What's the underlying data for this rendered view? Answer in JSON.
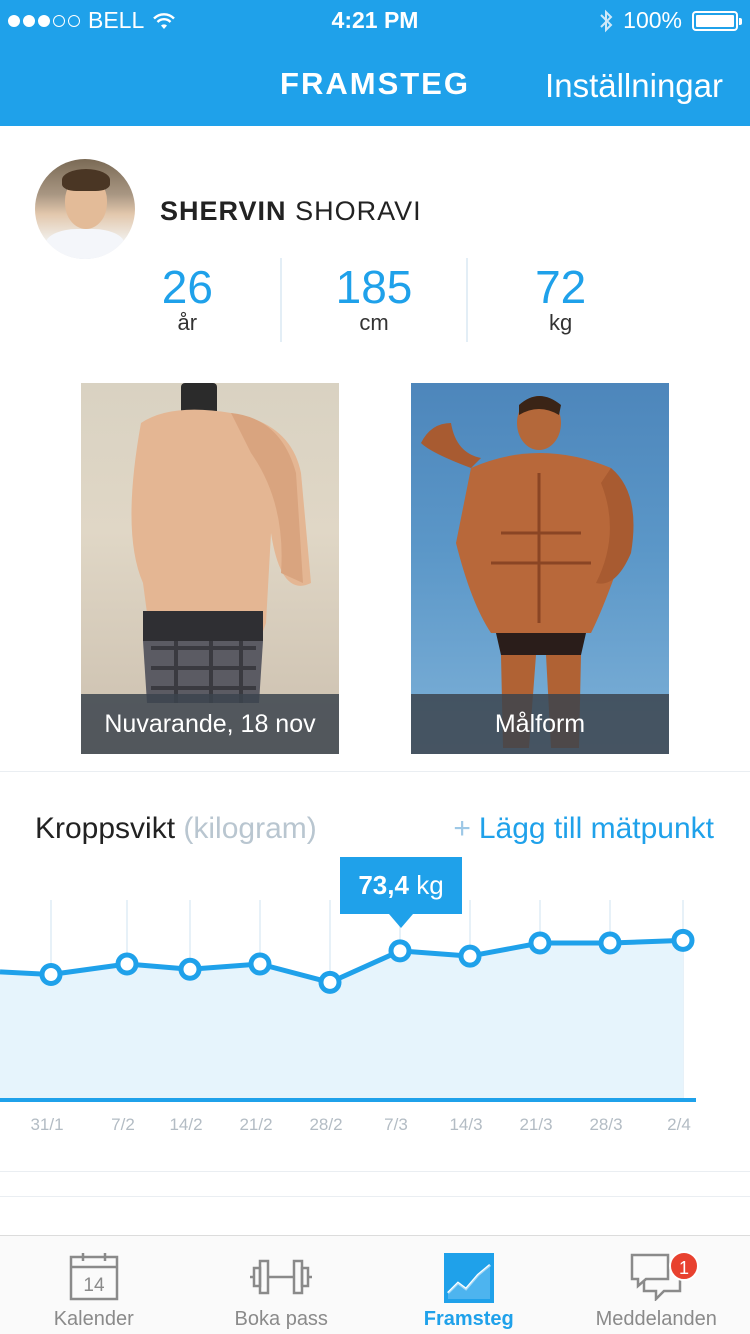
{
  "status_bar": {
    "carrier": "BELL",
    "signal_bars": 3,
    "signal_total": 5,
    "time": "4:21 PM",
    "battery": "100%",
    "battery_level": 1.0
  },
  "nav": {
    "title": "FRAMSTEG",
    "settings_label": "Inställningar"
  },
  "profile": {
    "first_name": "SHERVIN",
    "last_name": "SHORAVI",
    "stats": [
      {
        "value": "26",
        "unit": "år"
      },
      {
        "value": "185",
        "unit": "cm"
      },
      {
        "value": "72",
        "unit": "kg"
      }
    ]
  },
  "photos": {
    "current_caption": "Nuvarande, 18 nov",
    "goal_caption": "Målform"
  },
  "chart_section": {
    "title": "Kroppsvikt",
    "title_unit": "(kilogram)",
    "add_label": "+ Lägg till mätpunkt",
    "add_plus": "+",
    "add_text": "Lägg till mätpunkt",
    "tooltip_value": "73,4",
    "tooltip_unit": "kg"
  },
  "chart_data": {
    "type": "area",
    "title": "Kroppsvikt",
    "ylabel": "kilogram",
    "categories": [
      "31/1",
      "7/2",
      "14/2",
      "21/2",
      "28/2",
      "7/3",
      "14/3",
      "21/3",
      "28/3",
      "2/4"
    ],
    "series": [
      {
        "values": [
          72.5,
          72.9,
          72.7,
          72.9,
          72.2,
          73.4,
          73.2,
          73.7,
          73.7,
          73.8
        ]
      }
    ],
    "highlight": {
      "category": "7/3",
      "value": 73.4
    },
    "grid": true,
    "accent_color": "#1fa1ea",
    "fill_color": "#e6f4fc"
  },
  "tab_bar": {
    "items": [
      {
        "label": "Kalender",
        "icon": "calendar-icon",
        "day": "14"
      },
      {
        "label": "Boka pass",
        "icon": "dumbbell-icon"
      },
      {
        "label": "Framsteg",
        "icon": "progress-chart-icon",
        "active": true
      },
      {
        "label": "Meddelanden",
        "icon": "chat-bubbles-icon"
      }
    ],
    "badge_count": "1"
  },
  "colors": {
    "accent": "#1fa1ea",
    "badge": "#e8412f",
    "inactive": "#8a8a8a"
  }
}
